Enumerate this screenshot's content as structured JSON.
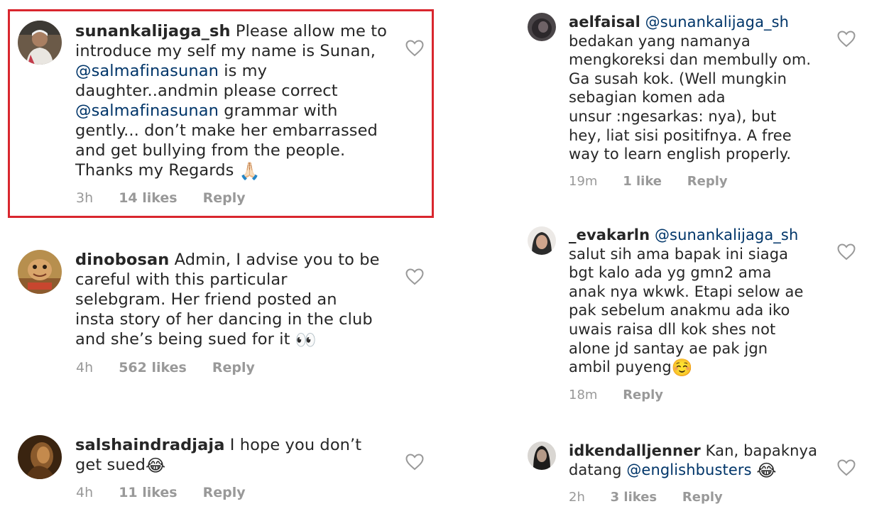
{
  "left_column": {
    "comments": [
      {
        "username": "sunankalijaga_sh",
        "text_parts": [
          " Please allow me to\nintroduce my self my name is Sunan,\n",
          "@salmafinasunan",
          " is my\ndaughter..andmin please correct\n",
          "@salmafinasunan",
          " grammar with\ngently... don’t make her embarrassed\nand get bullying from the people.\nThanks my Regards ",
          "🙏🏻"
        ],
        "time": "3h",
        "likes": "14 likes",
        "reply": "Reply",
        "highlighted": true
      },
      {
        "username": "dinobosan",
        "text_parts": [
          " Admin, I advise you to be\ncareful with this particular\nselebgram. Her friend posted an\ninsta story of her dancing in the club\nand she’s being sued for it ",
          "👀"
        ],
        "time": "4h",
        "likes": "562 likes",
        "reply": "Reply"
      },
      {
        "username": "salshaindradjaja",
        "text_parts": [
          " I hope you don’t\nget sued",
          "😂"
        ],
        "time": "4h",
        "likes": "11 likes",
        "reply": "Reply"
      }
    ]
  },
  "right_column": {
    "comments": [
      {
        "username": "aelfaisal",
        "text_parts": [
          " ",
          "@sunankalijaga_sh",
          "\nbedakan yang namanya\nmengkoreksi dan membully om.\nGa susah kok. (Well mungkin\nsebagian komen ada\nunsur :ngesarkas: nya), but\nhey, liat sisi positifnya. A free\nway to learn english properly."
        ],
        "time": "19m",
        "likes": "1 like",
        "reply": "Reply"
      },
      {
        "username": "_evakarln",
        "text_parts": [
          " ",
          "@sunankalijaga_sh",
          "\nsalut sih ama bapak ini siaga\nbgt kalo ada yg gmn2 ama\nanak nya wkwk. Etapi selow ae\npak sebelum anakmu ada iko\nuwais raisa dll kok shes not\nalone jd santay ae pak jgn\nambil puyeng",
          "☺️"
        ],
        "time": "18m",
        "reply": "Reply"
      },
      {
        "username": "idkendalljenner",
        "text_parts": [
          " Kan, bapaknya\ndatang  ",
          "@englishbusters",
          " ",
          "😂"
        ],
        "time": "2h",
        "likes": "3 likes",
        "reply": "Reply"
      }
    ]
  },
  "colors": {
    "text": "#262626",
    "mention": "#003569",
    "meta": "#999999",
    "highlight_border": "#d9262e"
  },
  "icons": [
    "like-heart-icon"
  ]
}
